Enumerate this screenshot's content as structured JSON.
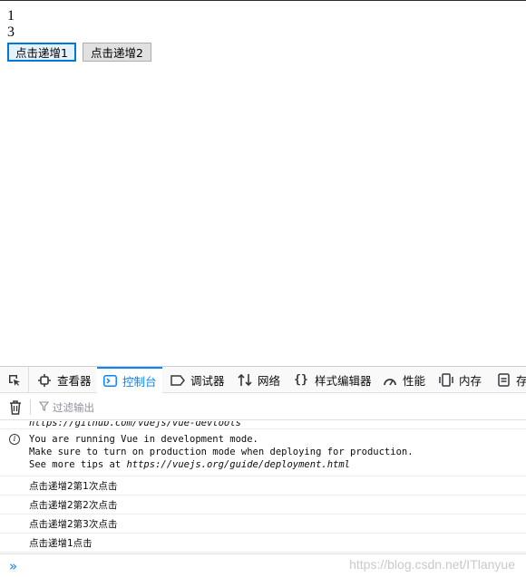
{
  "page": {
    "line1": "1",
    "line2": "3",
    "button1": "点击递增1",
    "button2": "点击递增2"
  },
  "devtools": {
    "tabs": [
      "查看器",
      "控制台",
      "调试器",
      "网络",
      "样式编辑器",
      "性能",
      "内存",
      "存"
    ],
    "active_tab": "控制台",
    "filter_placeholder": "过滤输出",
    "log": {
      "entry0": "https://github.com/vuejs/vue-devtools",
      "entry1_line1": "You are running Vue in development mode.",
      "entry1_line2": "Make sure to turn on production mode when deploying for production.",
      "entry1_line3_prefix": "See more tips at ",
      "entry1_line3_link": "https://vuejs.org/guide/deployment.html",
      "msg1": "点击递增2第1次点击",
      "msg2": "点击递增2第2次点击",
      "msg3": "点击递增2第3次点击",
      "msg4": "点击递增1点击"
    },
    "prompt": "»",
    "watermark": "https://blog.csdn.net/ITlanyue"
  },
  "colors": {
    "accent": "#0a84ff",
    "button_focus": "#0078d7"
  }
}
